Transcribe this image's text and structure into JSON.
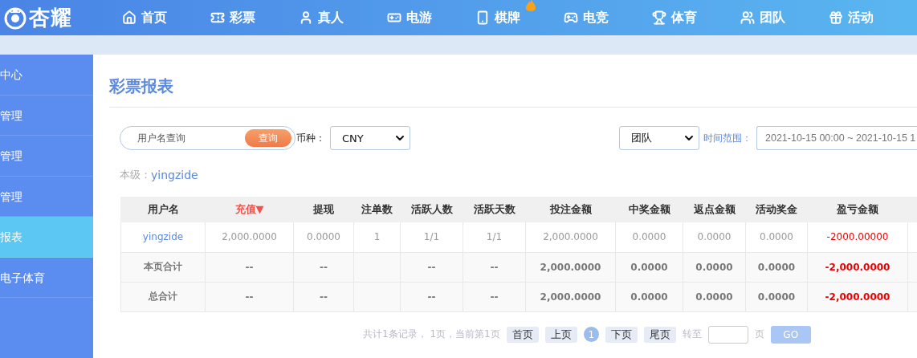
{
  "logo": {
    "text": "杏耀"
  },
  "nav": [
    {
      "label": "首页",
      "hot": false
    },
    {
      "label": "彩票",
      "hot": false
    },
    {
      "label": "真人",
      "hot": false
    },
    {
      "label": "电游",
      "hot": false
    },
    {
      "label": "棋牌",
      "hot": true
    },
    {
      "label": "电竞",
      "hot": false
    },
    {
      "label": "体育",
      "hot": false
    },
    {
      "label": "团队",
      "hot": false
    },
    {
      "label": "活动",
      "hot": false
    }
  ],
  "sidebar": {
    "items": [
      {
        "label": "中心",
        "selected": false
      },
      {
        "label": "管理",
        "selected": false
      },
      {
        "label": "管理",
        "selected": false
      },
      {
        "label": "管理",
        "selected": false
      },
      {
        "label": "报表",
        "selected": true
      },
      {
        "label": "电子体育",
        "selected": false
      }
    ]
  },
  "title": "彩票报表",
  "filters": {
    "search": {
      "placeholder": "用户名查询",
      "button": "查询"
    },
    "currency_label": "币种：",
    "currency": "CNY",
    "scope": "团队",
    "time_label": "时间范围：",
    "time_range": "2021-10-15 00:00 ~ 2021-10-15 1"
  },
  "level": {
    "label": "本级：",
    "user": "yingzide"
  },
  "table": {
    "columns": [
      {
        "label": "用户名",
        "sorted": false
      },
      {
        "label": "充值▼",
        "sorted": true
      },
      {
        "label": "提现",
        "sorted": false
      },
      {
        "label": "注单数",
        "sorted": false
      },
      {
        "label": "活跃人数",
        "sorted": false
      },
      {
        "label": "活跃天数",
        "sorted": false
      },
      {
        "label": "投注金额",
        "sorted": false
      },
      {
        "label": "中奖金额",
        "sorted": false
      },
      {
        "label": "返点金额",
        "sorted": false
      },
      {
        "label": "活动奖金",
        "sorted": false
      },
      {
        "label": "盈亏金额",
        "sorted": false
      }
    ],
    "rows": [
      {
        "kind": "user",
        "cells": [
          "yingzide",
          "2,000.0000",
          "0.0000",
          "1",
          "1/1",
          "1/1",
          "2,000.0000",
          "0.0000",
          "0.0000",
          "0.0000",
          "-2000.00000"
        ]
      },
      {
        "kind": "total",
        "cells": [
          "本页合计",
          "--",
          "--",
          "",
          "--",
          "--",
          "2,000.0000",
          "0.0000",
          "0.0000",
          "0.0000",
          "-2,000.0000"
        ]
      },
      {
        "kind": "total",
        "cells": [
          "总合计",
          "--",
          "--",
          "",
          "--",
          "--",
          "2,000.0000",
          "0.0000",
          "0.0000",
          "0.0000",
          "-2,000.0000"
        ]
      }
    ]
  },
  "pagination": {
    "summary": "共计1条记录，  1页，当前第1页",
    "first": "首页",
    "prev": "上页",
    "pages": [
      {
        "label": "1",
        "selected": true
      }
    ],
    "next": "下页",
    "last": "尾页",
    "goto_label": "转至",
    "page_unit": "页",
    "go": "GO"
  }
}
